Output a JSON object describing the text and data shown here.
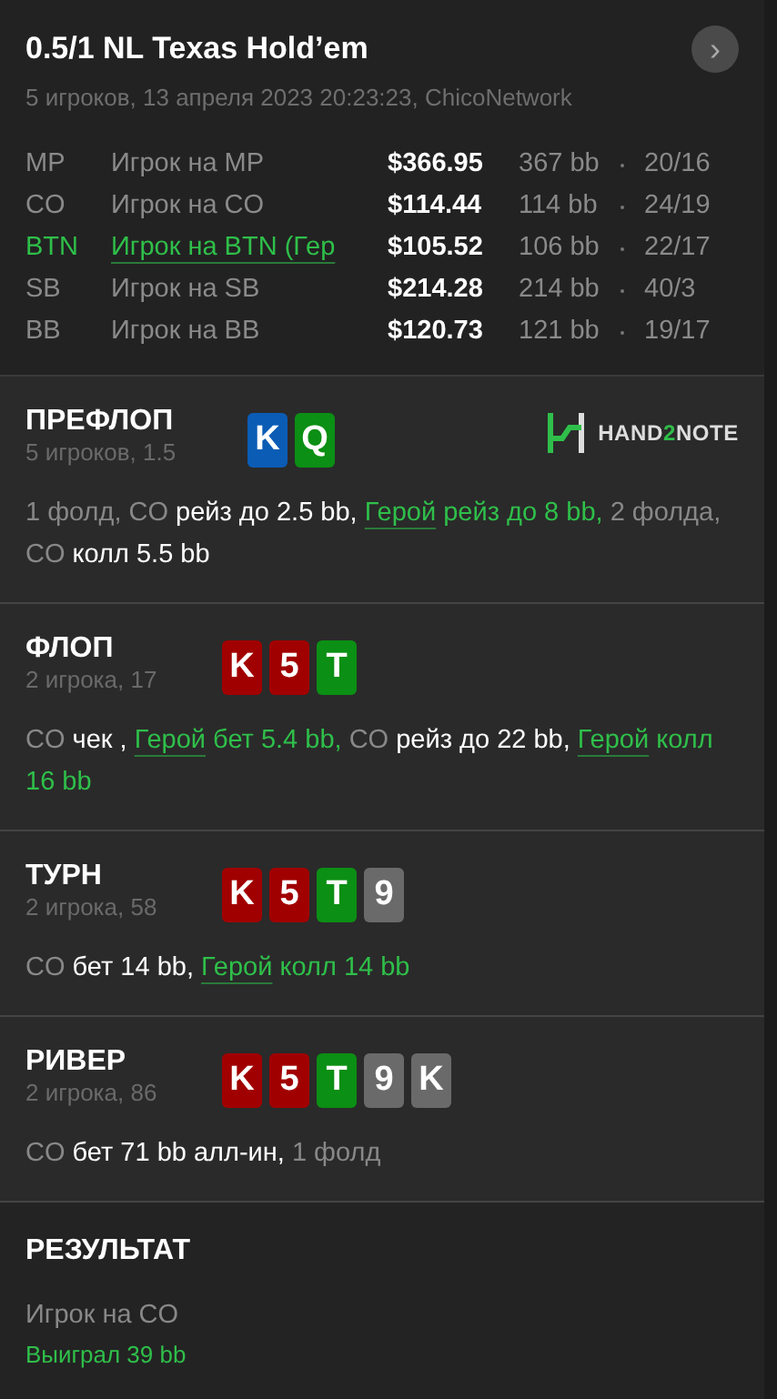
{
  "header": {
    "title": "0.5/1 NL Texas Hold’em",
    "subtitle": "5 игроков, 13 апреля 2023 20:23:23, ChicoNetwork",
    "next_button": "›"
  },
  "players": [
    {
      "position": "MP",
      "name": "Игрок на MP",
      "stack": "$366.95",
      "bb": "367 bb",
      "stats": "20/16",
      "hero": false
    },
    {
      "position": "CO",
      "name": "Игрок на CO",
      "stack": "$114.44",
      "bb": "114 bb",
      "stats": "24/19",
      "hero": false
    },
    {
      "position": "BTN",
      "name": "Игрок на BTN (Гер",
      "stack": "$105.52",
      "bb": "106 bb",
      "stats": "22/17",
      "hero": true
    },
    {
      "position": "SB",
      "name": "Игрок на SB",
      "stack": "$214.28",
      "bb": "214 bb",
      "stats": "40/3",
      "hero": false
    },
    {
      "position": "BB",
      "name": "Игрок на BB",
      "stack": "$120.73",
      "bb": "121 bb",
      "stats": "19/17",
      "hero": false
    }
  ],
  "streets": [
    {
      "title": "ПРЕФЛОП",
      "subtitle": "5 игроков, 1.5",
      "logo": {
        "parts": [
          "HAND",
          "2",
          "NOTE"
        ]
      },
      "cards": [
        {
          "rank": "K",
          "color": "#0b5cb5"
        },
        {
          "rank": "Q",
          "color": "#0b8f14"
        }
      ],
      "actions": [
        {
          "kind": "muted",
          "text": "1 фолд, CO "
        },
        {
          "kind": "action",
          "text": "рейз до 2.5 bb, "
        },
        {
          "kind": "hero-link",
          "text": "Герой"
        },
        {
          "kind": "hero",
          "text": " рейз до 8 bb, "
        },
        {
          "kind": "muted",
          "text": "2 фолда, CO "
        },
        {
          "kind": "action",
          "text": "колл 5.5 bb"
        }
      ]
    },
    {
      "title": "ФЛОП",
      "subtitle": "2 игрока, 17",
      "cards": [
        {
          "rank": "K",
          "color": "#a10000"
        },
        {
          "rank": "5",
          "color": "#a10000"
        },
        {
          "rank": "T",
          "color": "#0b8f14"
        }
      ],
      "actions": [
        {
          "kind": "muted",
          "text": "CO "
        },
        {
          "kind": "action",
          "text": "чек , "
        },
        {
          "kind": "hero-link",
          "text": "Герой"
        },
        {
          "kind": "hero",
          "text": " бет 5.4 bb, "
        },
        {
          "kind": "muted",
          "text": "CO "
        },
        {
          "kind": "action",
          "text": "рейз до 22 bb, "
        },
        {
          "kind": "hero-link",
          "text": "Герой"
        },
        {
          "kind": "hero",
          "text": " колл 16 bb"
        }
      ]
    },
    {
      "title": "ТУРН",
      "subtitle": "2 игрока, 58",
      "cards": [
        {
          "rank": "K",
          "color": "#a10000"
        },
        {
          "rank": "5",
          "color": "#a10000"
        },
        {
          "rank": "T",
          "color": "#0b8f14"
        },
        {
          "rank": "9",
          "color": "#6a6a6a"
        }
      ],
      "actions": [
        {
          "kind": "muted",
          "text": "CO "
        },
        {
          "kind": "action",
          "text": "бет 14 bb, "
        },
        {
          "kind": "hero-link",
          "text": "Герой"
        },
        {
          "kind": "hero",
          "text": " колл 14 bb"
        }
      ]
    },
    {
      "title": "РИВЕР",
      "subtitle": "2 игрока, 86",
      "cards": [
        {
          "rank": "K",
          "color": "#a10000"
        },
        {
          "rank": "5",
          "color": "#a10000"
        },
        {
          "rank": "T",
          "color": "#0b8f14"
        },
        {
          "rank": "9",
          "color": "#6a6a6a"
        },
        {
          "rank": "K",
          "color": "#6a6a6a"
        }
      ],
      "actions": [
        {
          "kind": "muted",
          "text": "CO "
        },
        {
          "kind": "action",
          "text": "бет 71 bb алл-ин, "
        },
        {
          "kind": "muted",
          "text": "1 фолд"
        }
      ]
    }
  ],
  "result": {
    "title": "РЕЗУЛЬТАТ",
    "player": "Игрок на CO",
    "outcome": "Выиграл 39 bb"
  }
}
